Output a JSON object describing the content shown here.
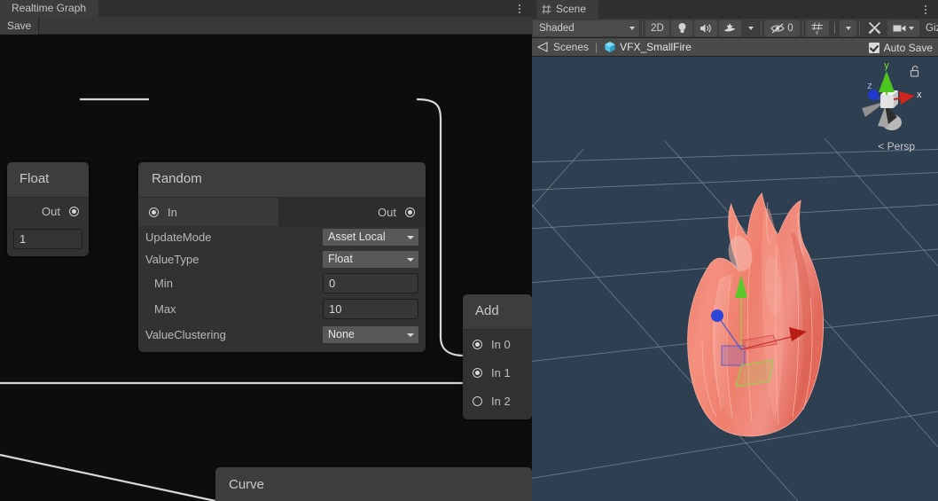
{
  "left_panel": {
    "tab_label": "Realtime Graph",
    "kebab_icon": "kebab-menu-icon",
    "toolbar": {
      "save_label": "Save"
    },
    "nodes": {
      "float": {
        "title": "Float",
        "out_port_label": "Out",
        "value": "1"
      },
      "random": {
        "title": "Random",
        "in_port_label": "In",
        "out_port_label": "Out",
        "properties": [
          {
            "label": "UpdateMode",
            "kind": "dropdown",
            "value": "Asset Local"
          },
          {
            "label": "ValueType",
            "kind": "dropdown",
            "value": "Float"
          },
          {
            "label": "Min",
            "kind": "input",
            "value": "0"
          },
          {
            "label": "Max",
            "kind": "input",
            "value": "10"
          },
          {
            "label": "ValueClustering",
            "kind": "dropdown",
            "value": "None"
          }
        ]
      },
      "add": {
        "title": "Add",
        "inputs": [
          {
            "label": "In 0",
            "connected": true
          },
          {
            "label": "In 1",
            "connected": true
          },
          {
            "label": "In 2",
            "connected": false
          }
        ]
      },
      "curve": {
        "title": "Curve"
      }
    },
    "colors": {
      "canvas_background": "#0d0d0d",
      "node_body": "#323232",
      "node_header": "#3d3d3d",
      "wire": "#d8d8d8",
      "dropdown": "#585858"
    }
  },
  "right_panel": {
    "tab_label": "Scene",
    "tab_icon": "grid-icon",
    "kebab_icon": "kebab-menu-icon",
    "toolbar": {
      "draw_mode": "Shaded",
      "two_d_label": "2D",
      "lighting_icon": "lightbulb-icon",
      "audio_icon": "speaker-icon",
      "fx_icon": "effects-icon",
      "hidden_objects_count": "0",
      "hidden_objects_icon": "eye-off-icon",
      "grid_icon": "grid-snap-icon",
      "tools_icon": "tools-icon",
      "camera_icon": "camera-icon",
      "gizmos_label": "Gizmos"
    },
    "breadcrumb": {
      "scenes_icon": "scene-icon",
      "scenes_label": "Scenes",
      "separator": "|",
      "asset_icon": "prefab-cube-icon",
      "asset_label": "VFX_SmallFire"
    },
    "auto_save": {
      "label": "Auto Save",
      "checked": true
    },
    "viewport": {
      "orientation_gizmo": {
        "x_label": "x",
        "y_label": "y",
        "z_label": "z",
        "projection_label": "< Persp",
        "lock_icon": "padlock-open-icon"
      },
      "object_name": "VFX_SmallFire",
      "colors": {
        "background": "#2d3f50",
        "grid": "#7f8c96",
        "mesh": "#f08878",
        "axis_x": "#c2261f",
        "axis_y": "#5cc92b",
        "axis_z": "#2b46d8"
      }
    }
  }
}
